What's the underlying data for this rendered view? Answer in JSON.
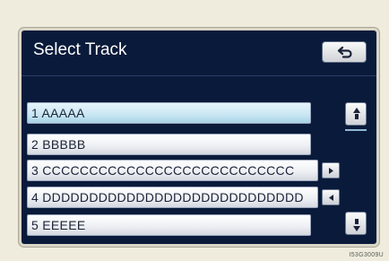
{
  "header": {
    "title": "Select Track"
  },
  "tracks": [
    {
      "label": "1  AAAAA"
    },
    {
      "label": "2  BBBBB"
    },
    {
      "label": "3  CCCCCCCCCCCCCCCCCCCCCCCCCCC"
    },
    {
      "label": "4  DDDDDDDDDDDDDDDDDDDDDDDDDDDD"
    },
    {
      "label": "5  EEEEE"
    }
  ],
  "icons": {
    "back": "back-arrow-icon",
    "scroll_right": "triangle-right-icon",
    "scroll_left": "triangle-left-icon",
    "scroll_up": "scroll-up-icon",
    "scroll_down": "scroll-down-icon"
  },
  "colors": {
    "screen_bg": "#0a1a3a",
    "selected_item": "#c8e6f3",
    "item": "#eef0f4"
  },
  "image_code": "I53G3009U"
}
